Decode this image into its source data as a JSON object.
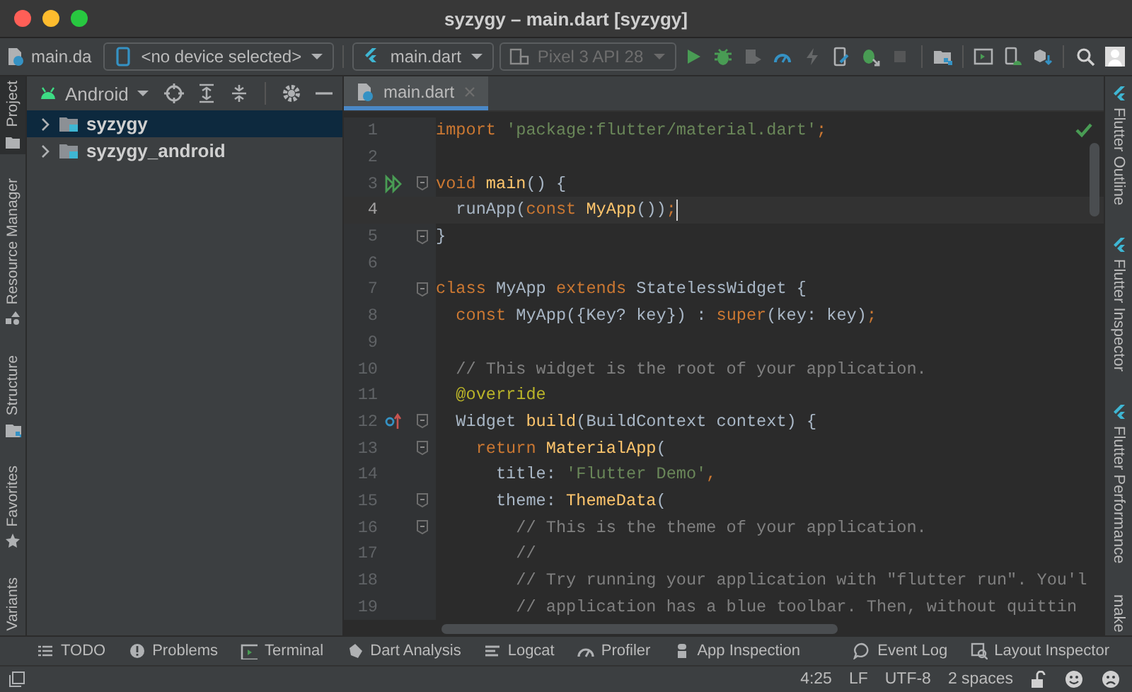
{
  "window": {
    "title": "syzygy – main.dart [syzygy]"
  },
  "toolbar": {
    "breadcrumb": "main.da",
    "device": "<no device selected>",
    "config": "main.dart",
    "emulator": {
      "label": "Pixel 3 API 28",
      "disabled": true
    },
    "buttons": [
      {
        "kind": "run",
        "disabled": false
      },
      {
        "kind": "debug",
        "disabled": false
      },
      {
        "kind": "attach",
        "disabled": true
      },
      {
        "kind": "profile",
        "disabled": false
      },
      {
        "kind": "reload",
        "disabled": true
      },
      {
        "kind": "device-edit",
        "disabled": false
      },
      {
        "kind": "debug-attach",
        "disabled": false
      },
      {
        "kind": "stop",
        "disabled": true
      },
      {
        "kind": "structure",
        "disabled": false
      },
      {
        "kind": "terminal",
        "disabled": false
      },
      {
        "kind": "device",
        "disabled": false
      },
      {
        "kind": "sdk",
        "disabled": false
      },
      {
        "kind": "search",
        "disabled": false
      },
      {
        "kind": "account",
        "disabled": false
      }
    ]
  },
  "left_strip": [
    {
      "label": "Project",
      "kind": "folder",
      "selected": true
    },
    {
      "label": "Resource Manager",
      "kind": "resources",
      "selected": false
    },
    {
      "label": "Structure",
      "kind": "structure",
      "selected": false
    },
    {
      "label": "Favorites",
      "kind": "star",
      "selected": false
    },
    {
      "label": "Variants",
      "kind": "none",
      "selected": false
    }
  ],
  "project": {
    "view": "Android",
    "tree": [
      {
        "label": "syzygy",
        "selected": true,
        "expanded": false
      },
      {
        "label": "syzygy_android",
        "selected": false,
        "expanded": false
      }
    ]
  },
  "editor": {
    "tabs": [
      {
        "label": "main.dart",
        "selected": true
      }
    ],
    "lines": [
      {
        "number": "1",
        "current": false,
        "fold": false,
        "kind": "plain",
        "tokens": [
          {
            "kind": "keyword",
            "text": "import "
          },
          {
            "kind": "string",
            "text": "'package:flutter/material.dart'"
          },
          {
            "kind": "keyword",
            "text": ";"
          }
        ]
      },
      {
        "number": "2",
        "current": false,
        "fold": false
      },
      {
        "number": "3",
        "current": false,
        "fold": true,
        "kind": "run",
        "tokens": [
          {
            "kind": "keyword",
            "text": "void "
          },
          {
            "kind": "function",
            "text": "main"
          },
          {
            "kind": "plain",
            "text": "() {"
          }
        ]
      },
      {
        "number": "4",
        "current": true,
        "fold": false,
        "tokens": [
          {
            "kind": "plain",
            "text": "  runApp("
          },
          {
            "kind": "keyword",
            "text": "const "
          },
          {
            "kind": "function",
            "text": "MyApp"
          },
          {
            "kind": "plain",
            "text": "())"
          },
          {
            "kind": "keyword",
            "text": ";"
          }
        ]
      },
      {
        "number": "5",
        "current": false,
        "fold": true,
        "tokens": [
          {
            "kind": "plain",
            "text": "}"
          }
        ]
      },
      {
        "number": "6",
        "current": false,
        "fold": false
      },
      {
        "number": "7",
        "current": false,
        "fold": true,
        "tokens": [
          {
            "kind": "keyword",
            "text": "class "
          },
          {
            "kind": "plain",
            "text": "MyApp "
          },
          {
            "kind": "keyword",
            "text": "extends "
          },
          {
            "kind": "plain",
            "text": "StatelessWidget {"
          }
        ]
      },
      {
        "number": "8",
        "current": false,
        "fold": false,
        "tokens": [
          {
            "kind": "keyword",
            "text": "  const "
          },
          {
            "kind": "plain",
            "text": "MyApp({Key? key}) : "
          },
          {
            "kind": "keyword",
            "text": "super"
          },
          {
            "kind": "plain",
            "text": "(key: key)"
          },
          {
            "kind": "keyword",
            "text": ";"
          }
        ]
      },
      {
        "number": "9",
        "current": false,
        "fold": false
      },
      {
        "number": "10",
        "current": false,
        "fold": false,
        "tokens": [
          {
            "kind": "comment",
            "text": "  // This widget is the root of your application."
          }
        ]
      },
      {
        "number": "11",
        "current": false,
        "fold": false,
        "tokens": [
          {
            "kind": "annotation",
            "text": "  @override"
          }
        ]
      },
      {
        "number": "12",
        "current": false,
        "fold": true,
        "kind": "override",
        "tokens": [
          {
            "kind": "plain",
            "text": "  Widget "
          },
          {
            "kind": "function",
            "text": "build"
          },
          {
            "kind": "plain",
            "text": "(BuildContext context) {"
          }
        ]
      },
      {
        "number": "13",
        "current": false,
        "fold": true,
        "tokens": [
          {
            "kind": "keyword",
            "text": "    return "
          },
          {
            "kind": "function",
            "text": "MaterialApp"
          },
          {
            "kind": "plain",
            "text": "("
          }
        ]
      },
      {
        "number": "14",
        "current": false,
        "fold": false,
        "tokens": [
          {
            "kind": "plain",
            "text": "      title: "
          },
          {
            "kind": "string",
            "text": "'Flutter Demo'"
          },
          {
            "kind": "keyword",
            "text": ","
          }
        ]
      },
      {
        "number": "15",
        "current": false,
        "fold": true,
        "tokens": [
          {
            "kind": "plain",
            "text": "      theme: "
          },
          {
            "kind": "function",
            "text": "ThemeData"
          },
          {
            "kind": "plain",
            "text": "("
          }
        ]
      },
      {
        "number": "16",
        "current": false,
        "fold": true,
        "tokens": [
          {
            "kind": "comment",
            "text": "        // This is the theme of your application."
          }
        ]
      },
      {
        "number": "17",
        "current": false,
        "fold": false,
        "tokens": [
          {
            "kind": "comment",
            "text": "        //"
          }
        ]
      },
      {
        "number": "18",
        "current": false,
        "fold": false,
        "tokens": [
          {
            "kind": "comment",
            "text": "        // Try running your application with \"flutter run\". You'l"
          }
        ]
      },
      {
        "number": "19",
        "current": false,
        "fold": false,
        "tokens": [
          {
            "kind": "comment",
            "text": "        // application has a blue toolbar. Then, without quittin"
          }
        ]
      }
    ]
  },
  "right_strip": [
    {
      "label": "Flutter Outline",
      "kind": "flutter"
    },
    {
      "label": "Flutter Inspector",
      "kind": "flutter"
    },
    {
      "label": "Flutter Performance",
      "kind": "flutter"
    },
    {
      "label": "make",
      "kind": "none"
    }
  ],
  "bottom_tools": [
    {
      "label": "TODO",
      "kind": "list"
    },
    {
      "label": "Problems",
      "kind": "problems"
    },
    {
      "label": "Terminal",
      "kind": "terminal"
    },
    {
      "label": "Dart Analysis",
      "kind": "analysis"
    },
    {
      "label": "Logcat",
      "kind": "logcat"
    },
    {
      "label": "Profiler",
      "kind": "profiler"
    },
    {
      "label": "App Inspection",
      "kind": "inspection"
    }
  ],
  "bottom_tools_right": [
    {
      "label": "Event Log",
      "kind": "eventlog"
    },
    {
      "label": "Layout Inspector",
      "kind": "layout"
    }
  ],
  "status_bar": {
    "items": [
      "4:25",
      "LF",
      "UTF-8",
      "2 spaces"
    ]
  }
}
